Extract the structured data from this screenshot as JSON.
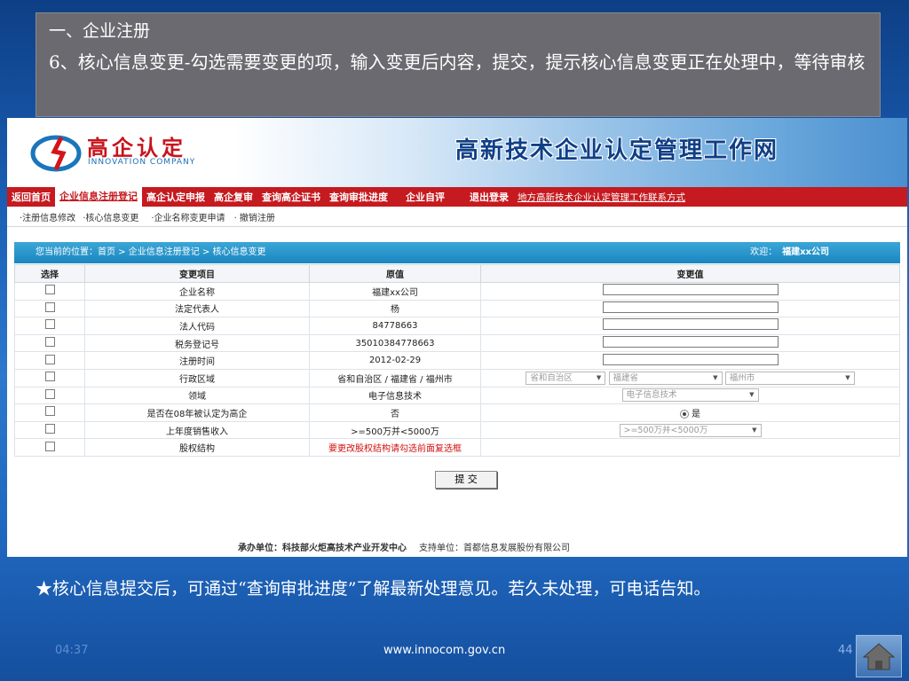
{
  "caption": {
    "line1": "一、企业注册",
    "line2": "6、核心信息变更-勾选需要变更的项，输入变更后内容，提交，提示核心信息变更正在处理中，等待审核"
  },
  "site": {
    "logo_cn": "高企认定",
    "logo_en": "INNOVATION COMPANY",
    "title": "高新技术企业认定管理工作网",
    "nav": [
      {
        "label": "返回首页"
      },
      {
        "label": "企业信息注册登记"
      },
      {
        "label": "高企认定申报"
      },
      {
        "label": "高企复审"
      },
      {
        "label": "查询高企证书"
      },
      {
        "label": "查询审批进度"
      },
      {
        "label": "企业自评"
      },
      {
        "label": "退出登录"
      },
      {
        "label": "地方高新技术企业认定管理工作联系方式"
      }
    ],
    "subnav": [
      "·注册信息修改",
      "·核心信息变更",
      "·企业名称变更申请",
      "· 撤销注册"
    ],
    "breadcrumb": "您当前的位置：首页 > 企业信息注册登记 > 核心信息变更",
    "welcome_label": "欢迎：",
    "welcome_company": "福建xx公司"
  },
  "table": {
    "headers": [
      "选择",
      "变更项目",
      "原值",
      "变更值"
    ],
    "rows": [
      {
        "item": "企业名称",
        "orig": "福建xx公司"
      },
      {
        "item": "法定代表人",
        "orig": "杨"
      },
      {
        "item": "法人代码",
        "orig": "84778663"
      },
      {
        "item": "税务登记号",
        "orig": "35010384778663"
      },
      {
        "item": "注册时间",
        "orig": "2012-02-29"
      },
      {
        "item": "行政区域",
        "orig": "省和自治区 / 福建省 / 福州市"
      },
      {
        "item": "领域",
        "orig": "电子信息技术"
      },
      {
        "item": "是否在08年被认定为高企",
        "orig": "否"
      },
      {
        "item": "上年度销售收入",
        "orig": ">=500万并<5000万"
      },
      {
        "item": "股权结构",
        "orig": "要更改股权结构请勾选前面复选框"
      }
    ],
    "region_selects": [
      "省和自治区",
      "福建省",
      "福州市"
    ],
    "field_select": "电子信息技术",
    "radio_label": "是",
    "sales_select": ">=500万并<5000万",
    "submit": "提 交"
  },
  "footer": {
    "host": "承办单位：科技部火炬高技术产业开发中心",
    "support": "支持单位：首都信息发展股份有限公司"
  },
  "note": "★核心信息提交后，可通过“查询审批进度”了解最新处理意见。若久未处理，可电话告知。",
  "slide": {
    "time": "04:37",
    "url": "www.innocom.gov.cn",
    "page": "44"
  },
  "icons": {
    "home": "home-icon",
    "logo": "swirl-logo-icon",
    "dropdown": "chevron-down-icon"
  },
  "colors": {
    "nav_red": "#c51a1f",
    "crumb_blue": "#1a86c0",
    "title_blue": "#0f3f86",
    "slide_bg": "#1a5fb4"
  }
}
